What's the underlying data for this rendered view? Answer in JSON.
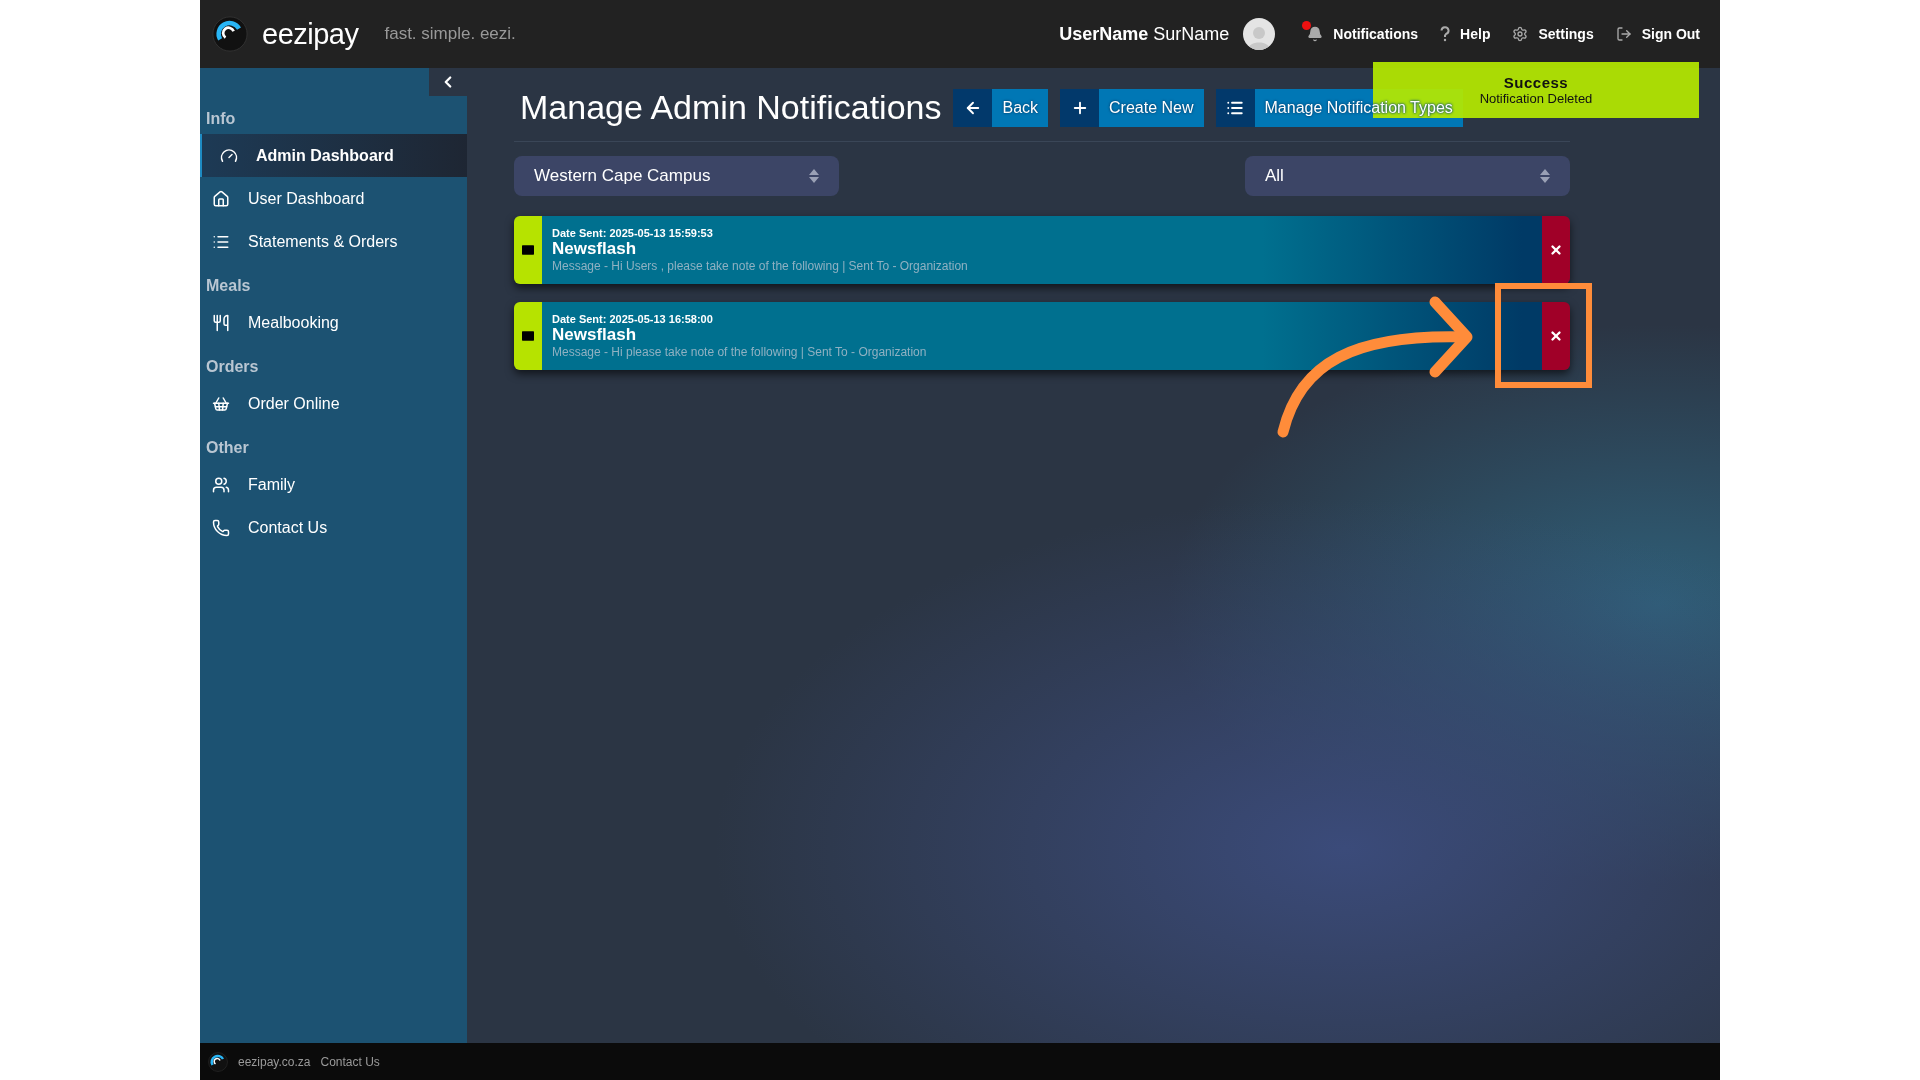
{
  "header": {
    "brand": "eezipay",
    "tagline": "fast. simple. eezi.",
    "user": "**UserName** SurName",
    "links": [
      {
        "kind": "notifications",
        "label": "Notifications",
        "unread": true
      },
      {
        "kind": "help",
        "label": "Help"
      },
      {
        "kind": "settings",
        "label": "Settings"
      },
      {
        "kind": "signout",
        "label": "Sign Out"
      }
    ]
  },
  "sidebar": {
    "sections": [
      {
        "title": "Info",
        "items": [
          {
            "kind": "dashboard",
            "label": "Admin Dashboard",
            "selected": true
          },
          {
            "kind": "home",
            "label": "User Dashboard",
            "selected": false
          },
          {
            "kind": "list",
            "label": "Statements & Orders",
            "selected": false
          }
        ]
      },
      {
        "title": "Meals",
        "items": [
          {
            "kind": "meal",
            "label": "Mealbooking",
            "selected": false
          }
        ]
      },
      {
        "title": "Orders",
        "items": [
          {
            "kind": "basket",
            "label": "Order Online",
            "selected": false
          }
        ]
      },
      {
        "title": "Other",
        "items": [
          {
            "kind": "family",
            "label": "Family",
            "selected": false
          },
          {
            "kind": "phone",
            "label": "Contact Us",
            "selected": false
          }
        ]
      }
    ]
  },
  "page": {
    "title": "Manage Admin Notifications",
    "buttons": [
      {
        "kind": "back",
        "label": "Back"
      },
      {
        "kind": "create",
        "label": "Create New"
      },
      {
        "kind": "list",
        "label": "Manage Notification Types"
      }
    ],
    "filters": [
      {
        "value": "Western Cape Campus"
      },
      {
        "value": "All"
      }
    ],
    "notifications": [
      {
        "date": "Date Sent: 2025-05-13 15:59:53",
        "title": "Newsflash",
        "message": "Message - Hi Users , please take note of the following | Sent To - Organization"
      },
      {
        "date": "Date Sent: 2025-05-13 16:58:00",
        "title": "Newsflash",
        "message": "Message - Hi please take note of the following | Sent To - Organization"
      }
    ]
  },
  "toast": {
    "title": "Success",
    "message": "Notification Deleted"
  },
  "footer": {
    "links": [
      "eezipay.co.za",
      "Contact Us"
    ]
  }
}
